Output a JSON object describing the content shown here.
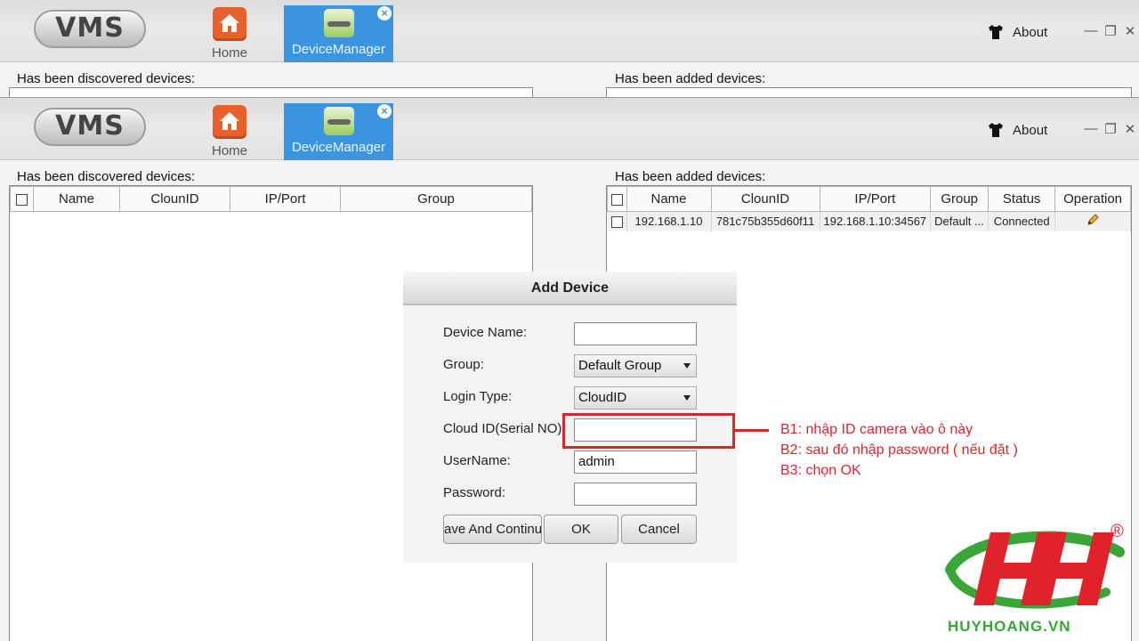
{
  "app": {
    "logo": "VMS",
    "tabs": {
      "home": "Home",
      "device_manager": "DeviceManager",
      "close": "×"
    },
    "about": "About",
    "window_controls": {
      "minimize": "—",
      "restore": "❐",
      "close": "✕"
    }
  },
  "discovered": {
    "label": "Has been discovered devices:",
    "columns": [
      "Name",
      "ClounID",
      "IP/Port",
      "Group"
    ]
  },
  "added": {
    "label": "Has been added devices:",
    "columns": [
      "Name",
      "ClounID",
      "IP/Port",
      "Group",
      "Status",
      "Operation"
    ],
    "rows": [
      {
        "name": "192.168.1.10",
        "cloudid": "781c75b355d60f11",
        "ipport": "192.168.1.10:34567",
        "group": "Default ...",
        "status": "Connected",
        "operation_icon": "pencil-icon"
      }
    ]
  },
  "dialog": {
    "title": "Add Device",
    "device_name_label": "Device Name:",
    "device_name_value": "",
    "group_label": "Group:",
    "group_value": "Default Group",
    "login_type_label": "Login Type:",
    "login_type_value": "CloudID",
    "cloud_id_label": "Cloud ID(Serial NO)",
    "cloud_id_value": "",
    "username_label": "UserName:",
    "username_value": "admin",
    "password_label": "Password:",
    "password_value": "",
    "save_continue_label": "ave And Continu",
    "ok_label": "OK",
    "cancel_label": "Cancel"
  },
  "annotation": {
    "color": "#d9262e",
    "step1": "B1: nhập ID camera vào ô này",
    "step2": "B2: sau đó nhập password ( nếu đặt )",
    "step3": "B3: chọn OK"
  },
  "watermark": {
    "text": "HUYHOANG.VN",
    "mark": "®",
    "color_red": "#e0232a",
    "color_green": "#3aa639"
  },
  "colors": {
    "tab_active": "#3c95e0",
    "home_icon": "#e8602c"
  }
}
